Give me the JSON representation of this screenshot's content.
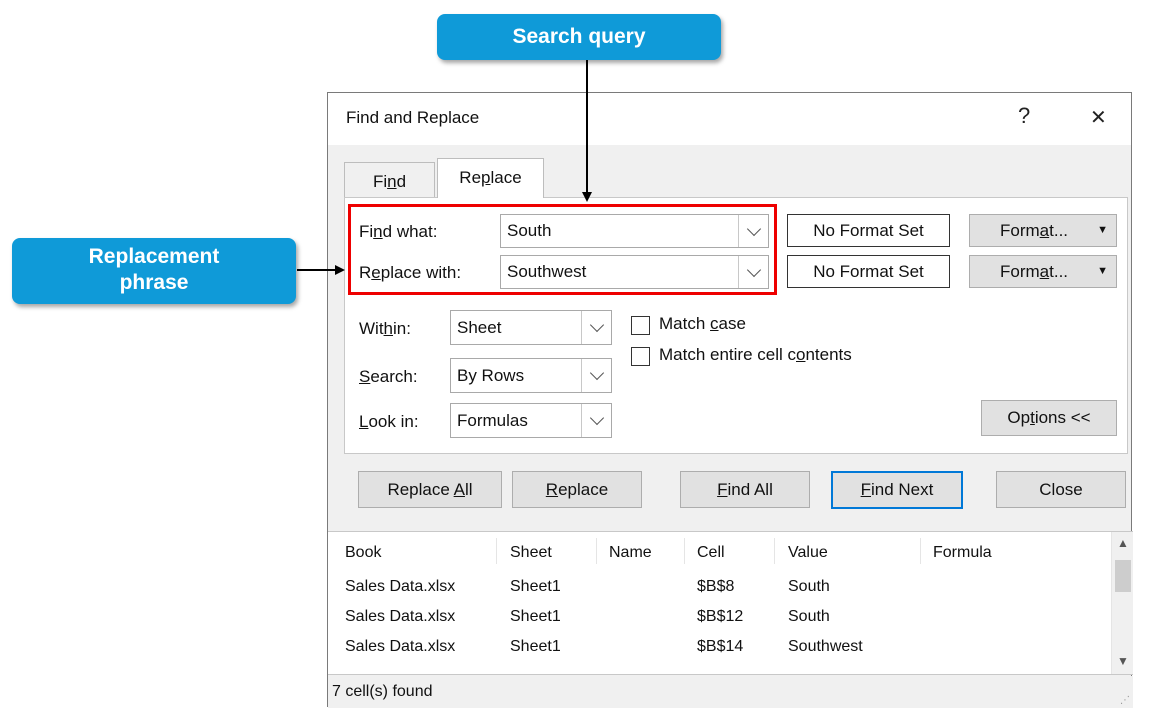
{
  "callouts": {
    "search_query": "Search query",
    "replacement_line1": "Replacement",
    "replacement_line2": "phrase"
  },
  "dialog": {
    "title": "Find and Replace",
    "help": "?",
    "close": "✕",
    "tabs": {
      "find": {
        "pre": "Fi",
        "key": "n",
        "post": "d"
      },
      "replace": {
        "pre": "Re",
        "key": "p",
        "post": "lace"
      }
    },
    "find_what": {
      "label": {
        "pre": "Fi",
        "key": "n",
        "post": "d what:"
      },
      "value": "South",
      "format_status": "No Format Set",
      "format_btn": {
        "pre": "Form",
        "key": "a",
        "post": "t..."
      }
    },
    "replace_with": {
      "label": {
        "pre": "R",
        "key": "e",
        "post": "place with:"
      },
      "value": "Southwest",
      "format_status": "No Format Set",
      "format_btn": {
        "pre": "Form",
        "key": "a",
        "post": "t..."
      }
    },
    "within": {
      "label": {
        "pre": "Wit",
        "key": "h",
        "post": "in:"
      },
      "value": "Sheet"
    },
    "search": {
      "label": {
        "pre": "",
        "key": "S",
        "post": "earch:"
      },
      "value": "By Rows"
    },
    "look_in": {
      "label": {
        "pre": "",
        "key": "L",
        "post": "ook in:"
      },
      "value": "Formulas"
    },
    "match_case": {
      "pre": "Match ",
      "key": "c",
      "post": "ase",
      "checked": false
    },
    "match_entire": {
      "pre": "Match entire cell c",
      "key": "o",
      "post": "ntents",
      "checked": false
    },
    "options_btn": {
      "pre": "Op",
      "key": "t",
      "post": "ions <<"
    },
    "buttons": {
      "replace_all": {
        "pre": "Replace ",
        "key": "A",
        "post": "ll"
      },
      "replace": {
        "pre": "",
        "key": "R",
        "post": "eplace"
      },
      "find_all": {
        "pre": "",
        "key": "F",
        "post": "ind All"
      },
      "find_next": {
        "pre": "",
        "key": "F",
        "post": "ind Next"
      },
      "close": "Close"
    },
    "results": {
      "columns": [
        "Book",
        "Sheet",
        "Name",
        "Cell",
        "Value",
        "Formula"
      ],
      "rows": [
        [
          "Sales Data.xlsx",
          "Sheet1",
          "",
          "$B$8",
          "South",
          ""
        ],
        [
          "Sales Data.xlsx",
          "Sheet1",
          "",
          "$B$12",
          "South",
          ""
        ],
        [
          "Sales Data.xlsx",
          "Sheet1",
          "",
          "$B$14",
          "Southwest",
          ""
        ]
      ]
    },
    "status": "7 cell(s) found"
  }
}
